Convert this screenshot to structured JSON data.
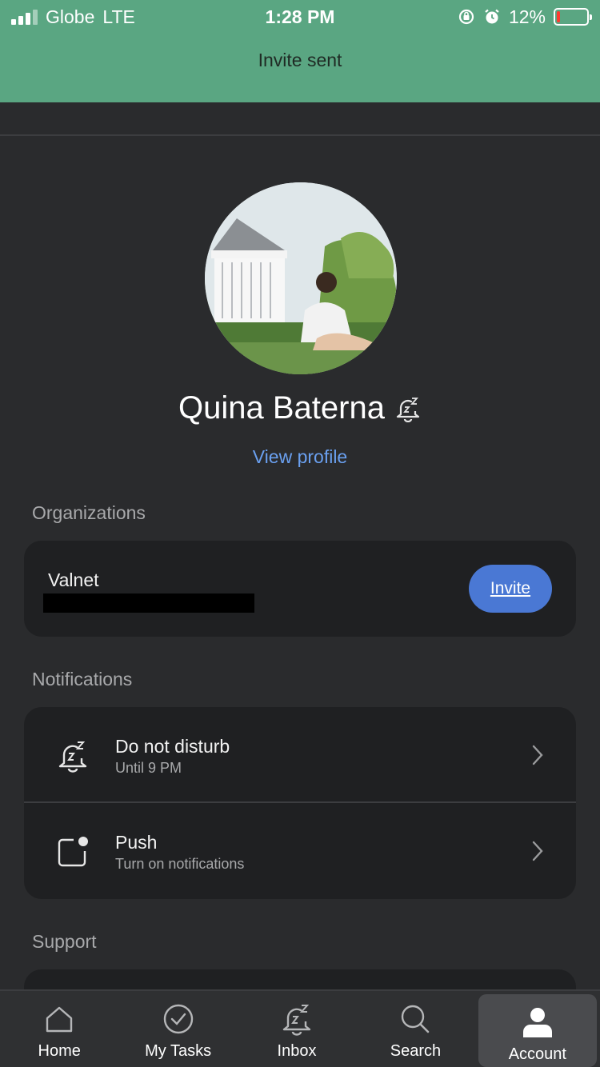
{
  "status_bar": {
    "carrier": "Globe",
    "network": "LTE",
    "time": "1:28 PM",
    "battery_percent": "12%",
    "battery_level": 0.12
  },
  "toast": {
    "message": "Invite sent"
  },
  "profile": {
    "name": "Quina Baterna",
    "status_icon": "bell-snooze-icon",
    "view_profile_label": "View profile"
  },
  "sections": {
    "organizations": "Organizations",
    "notifications": "Notifications",
    "support": "Support"
  },
  "organizations": [
    {
      "name": "Valnet",
      "invite_label": "Invite"
    }
  ],
  "notifications": [
    {
      "title": "Do not disturb",
      "subtitle": "Until 9 PM",
      "icon": "bell-snooze-icon"
    },
    {
      "title": "Push",
      "subtitle": "Turn on notifications",
      "icon": "push-notification-icon"
    }
  ],
  "tabs": [
    {
      "label": "Home",
      "icon": "home-icon",
      "active": false
    },
    {
      "label": "My Tasks",
      "icon": "check-circle-icon",
      "active": false
    },
    {
      "label": "Inbox",
      "icon": "bell-snooze-icon",
      "active": false
    },
    {
      "label": "Search",
      "icon": "search-icon",
      "active": false
    },
    {
      "label": "Account",
      "icon": "account-icon",
      "active": true
    }
  ],
  "colors": {
    "banner": "#5aa682",
    "background": "#2a2b2d",
    "card": "#1f2022",
    "link": "#6aa0f0",
    "button": "#4a78d4"
  }
}
